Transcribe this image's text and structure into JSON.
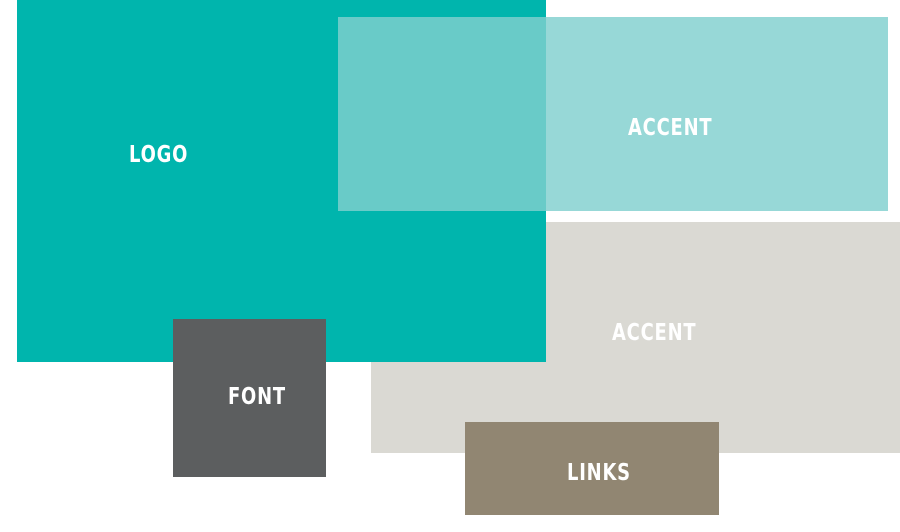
{
  "swatches": {
    "logo": {
      "label": "LOGO",
      "color": "#00b5ad"
    },
    "accent_top": {
      "label": "ACCENT",
      "color": "#80d0ce"
    },
    "accent_bottom": {
      "label": "ACCENT",
      "color": "#dad9d3"
    },
    "font": {
      "label": "FONT",
      "color": "#5c5e5f"
    },
    "links": {
      "label": "LINKS",
      "color": "#918672"
    }
  }
}
